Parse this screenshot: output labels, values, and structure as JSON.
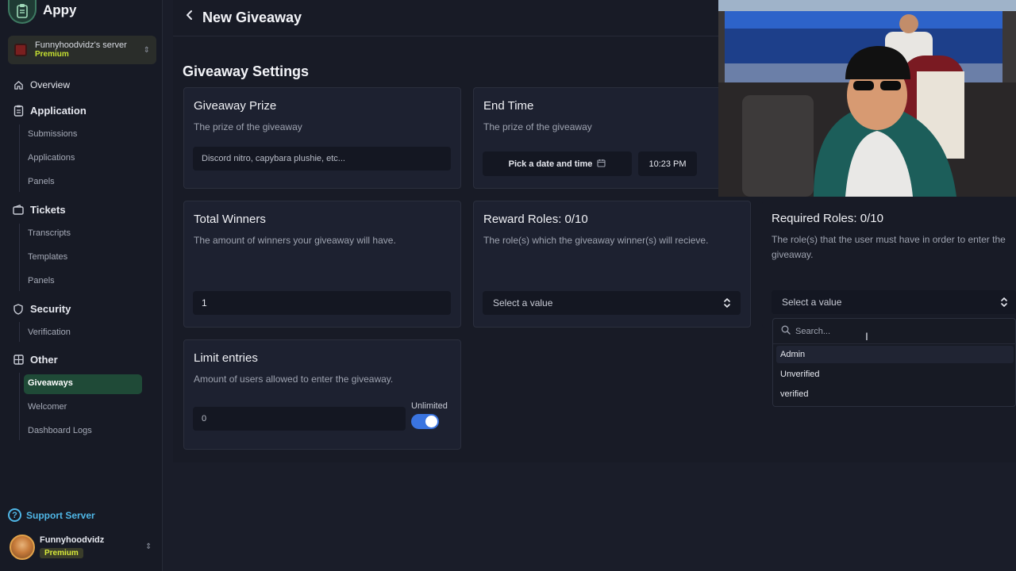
{
  "app": {
    "name": "Appy"
  },
  "server": {
    "name": "Funnyhoodvidz's server",
    "badge": "Premium"
  },
  "nav": {
    "overview": "Overview",
    "application": {
      "label": "Application",
      "items": [
        "Submissions",
        "Applications",
        "Panels"
      ]
    },
    "tickets": {
      "label": "Tickets",
      "items": [
        "Transcripts",
        "Templates",
        "Panels"
      ]
    },
    "security": {
      "label": "Security",
      "items": [
        "Verification"
      ]
    },
    "other": {
      "label": "Other",
      "items": [
        "Giveaways",
        "Welcomer",
        "Dashboard Logs"
      ],
      "active": "Giveaways"
    }
  },
  "support": {
    "label": "Support Server"
  },
  "user": {
    "name": "Funnyhoodvidz",
    "badge": "Premium"
  },
  "header": {
    "title": "New Giveaway"
  },
  "settings": {
    "title": "Giveaway Settings",
    "prize": {
      "title": "Giveaway Prize",
      "desc": "The prize of the giveaway",
      "placeholder": "Discord nitro, capybara plushie, etc..."
    },
    "end_time": {
      "title": "End Time",
      "desc": "The prize of the giveaway",
      "date_button": "Pick a date and time",
      "time": "10:23 PM"
    },
    "winners": {
      "title": "Total Winners",
      "desc": "The amount of winners your giveaway will have.",
      "value": "1"
    },
    "reward_roles": {
      "title": "Reward Roles: 0/10",
      "desc": "The role(s) which the giveaway winner(s) will recieve.",
      "placeholder": "Select a value"
    },
    "required_roles": {
      "title": "Required Roles: 0/10",
      "desc": "The role(s) that the user must have in order to enter the giveaway.",
      "placeholder": "Select a value"
    },
    "limit": {
      "title": "Limit entries",
      "desc": "Amount of users allowed to enter the giveaway.",
      "value": "0",
      "toggle_label": "Unlimited",
      "toggle_on": true
    }
  },
  "dropdown": {
    "search_placeholder": "Search...",
    "options": [
      "Admin",
      "Unverified",
      "verified"
    ],
    "highlighted": "Admin"
  },
  "colors": {
    "accent_green": "#1f4a37",
    "toggle_blue": "#3a74e0",
    "support_blue": "#4fb6e6",
    "premium_yellow": "#c6e031"
  }
}
